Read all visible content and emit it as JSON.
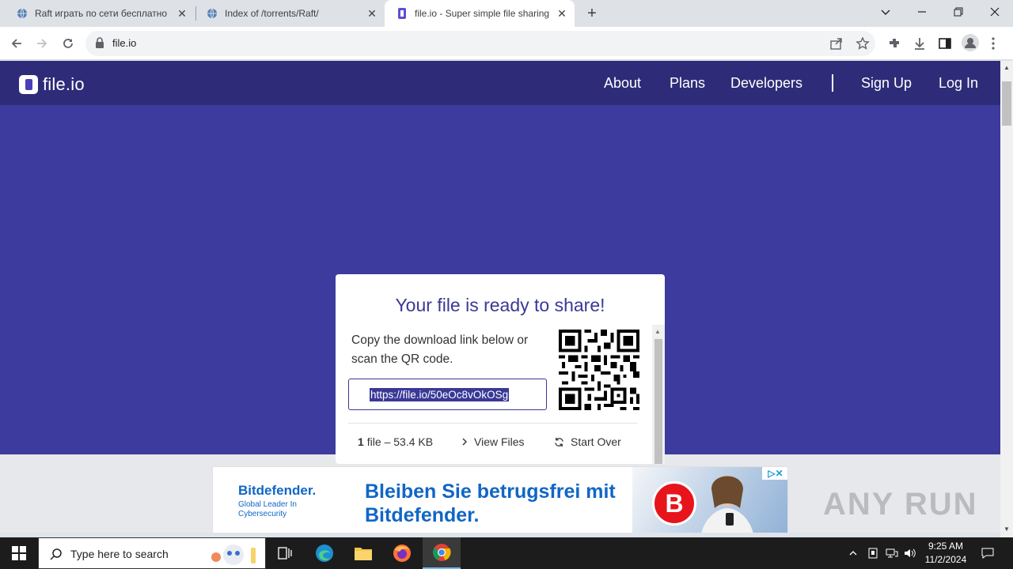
{
  "browser": {
    "tabs": [
      {
        "title": "Raft играть по сети бесплатно",
        "icon": "globe-icon"
      },
      {
        "title": "Index of /torrents/Raft/",
        "icon": "globe-icon"
      },
      {
        "title": "file.io - Super simple file sharing",
        "icon": "fileio-icon"
      }
    ],
    "active_tab": 2,
    "url": "file.io"
  },
  "site": {
    "logo_text": "file.io",
    "nav": {
      "about": "About",
      "plans": "Plans",
      "developers": "Developers",
      "signup": "Sign Up",
      "login": "Log In"
    }
  },
  "card": {
    "title": "Your file is ready to share!",
    "description": "Copy the download link below or scan the QR code.",
    "link": "https://file.io/50eOc8vOkOSg",
    "files_count": "1",
    "files_info": "file – 53.4 KB",
    "view_files": "View Files",
    "start_over": "Start Over"
  },
  "ad": {
    "brand": "Bitdefender.",
    "tagline": "Global Leader In Cybersecurity",
    "headline": "Bleiben Sie betrugsfrei mit Bitdefender.",
    "badge": "B"
  },
  "watermark": "ANY RUN",
  "taskbar": {
    "search_placeholder": "Type here to search",
    "time": "9:25 AM",
    "date": "11/2/2024"
  },
  "colors": {
    "page_bg": "#3d3b9d",
    "header_bg": "#2e2c78",
    "accent": "#3a3896",
    "ad_blue": "#1166c6",
    "ad_red": "#e8141c"
  }
}
